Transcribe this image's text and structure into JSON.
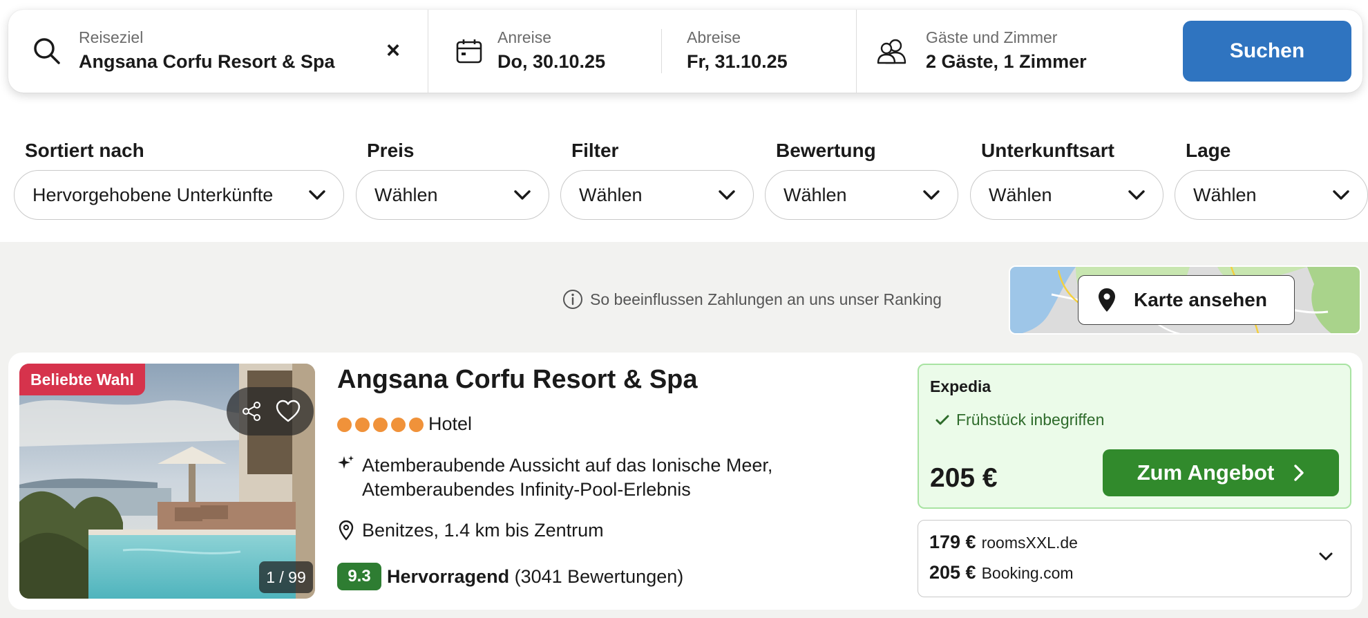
{
  "search": {
    "destination_label": "Reiseziel",
    "destination_value": "Angsana Corfu Resort & Spa",
    "clear_icon": "close-icon",
    "checkin_label": "Anreise",
    "checkin_value": "Do, 30.10.25",
    "checkout_label": "Abreise",
    "checkout_value": "Fr, 31.10.25",
    "guests_label": "Gäste und Zimmer",
    "guests_value": "2 Gäste, 1 Zimmer",
    "search_button": "Suchen",
    "accent_color": "#2f74c0"
  },
  "filters": [
    {
      "title": "Sortiert nach",
      "value": "Hervorgehobene Unterkünfte"
    },
    {
      "title": "Preis",
      "value": "Wählen"
    },
    {
      "title": "Filter",
      "value": "Wählen"
    },
    {
      "title": "Bewertung",
      "value": "Wählen"
    },
    {
      "title": "Unterkunftsart",
      "value": "Wählen"
    },
    {
      "title": "Lage",
      "value": "Wählen"
    }
  ],
  "ranking_info": "So beeinflussen Zahlungen an uns unser Ranking",
  "map_button": "Karte ansehen",
  "result": {
    "badge": "Beliebte Wahl",
    "badge_color": "#d6334c",
    "photo_counter": "1 / 99",
    "name": "Angsana Corfu Resort & Spa",
    "stars": 5,
    "type": "Hotel",
    "highlights": "Atemberaubende Aussicht auf das Ionische Meer, Atemberaubendes Infinity-Pool-Erlebnis",
    "location": "Benitzes, 1.4 km bis Zentrum",
    "score": "9.3",
    "score_color": "#2e7d32",
    "rating_label": "Hervorragend",
    "review_count": "(3041 Bewertungen)",
    "offer": {
      "provider": "Expedia",
      "perk": "Frühstück inbegriffen",
      "price": "205 €",
      "cta": "Zum Angebot",
      "cta_color": "#318a2c"
    },
    "alternatives": [
      {
        "price": "179 €",
        "provider": "roomsXXL.de"
      },
      {
        "price": "205 €",
        "provider": "Booking.com"
      }
    ]
  }
}
